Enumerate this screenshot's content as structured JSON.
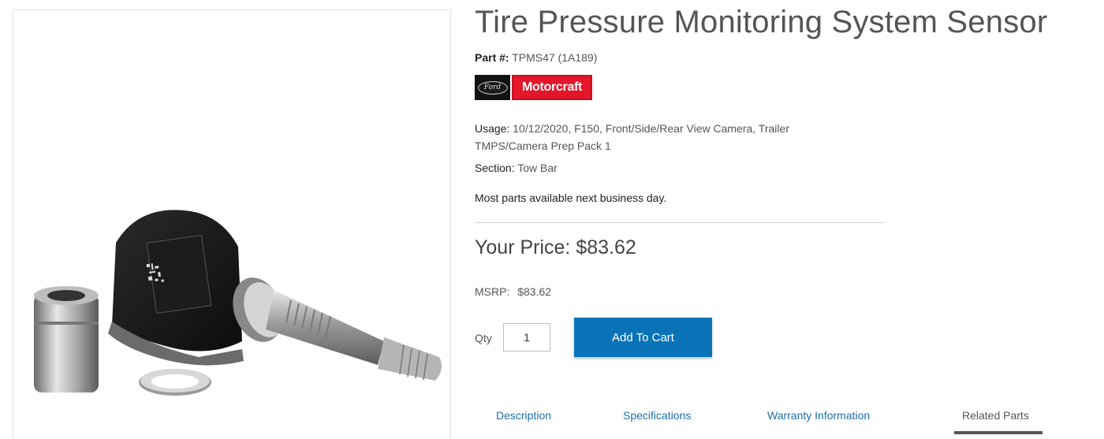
{
  "product": {
    "title": "Tire Pressure Monitoring System Sensor",
    "part_label": "Part #:",
    "part_number": "TPMS47 (1A189)",
    "brands": {
      "ford": "Ford",
      "motorcraft": "Motorcraft"
    },
    "usage_label": "Usage:",
    "usage_value": "10/12/2020, F150, Front/Side/Rear View Camera, Trailer TMPS/Camera Prep Pack 1",
    "section_label": "Section:",
    "section_value": "Tow Bar",
    "availability": "Most parts available next business day."
  },
  "pricing": {
    "your_price_label": "Your Price:",
    "your_price": "$83.62",
    "msrp_label": "MSRP:",
    "msrp": "$83.62"
  },
  "cart": {
    "qty_label": "Qty",
    "qty_value": "1",
    "add_button": "Add To Cart"
  },
  "tabs": [
    {
      "label": "Description",
      "active": false
    },
    {
      "label": "Specifications",
      "active": false
    },
    {
      "label": "Warranty Information",
      "active": false
    },
    {
      "label": "Related Parts",
      "active": true
    }
  ],
  "colors": {
    "accent": "#0a73b8",
    "link": "#1f6fa8",
    "brand_red": "#e4162a"
  },
  "image": {
    "subject": "tpms-sensor-kit"
  }
}
